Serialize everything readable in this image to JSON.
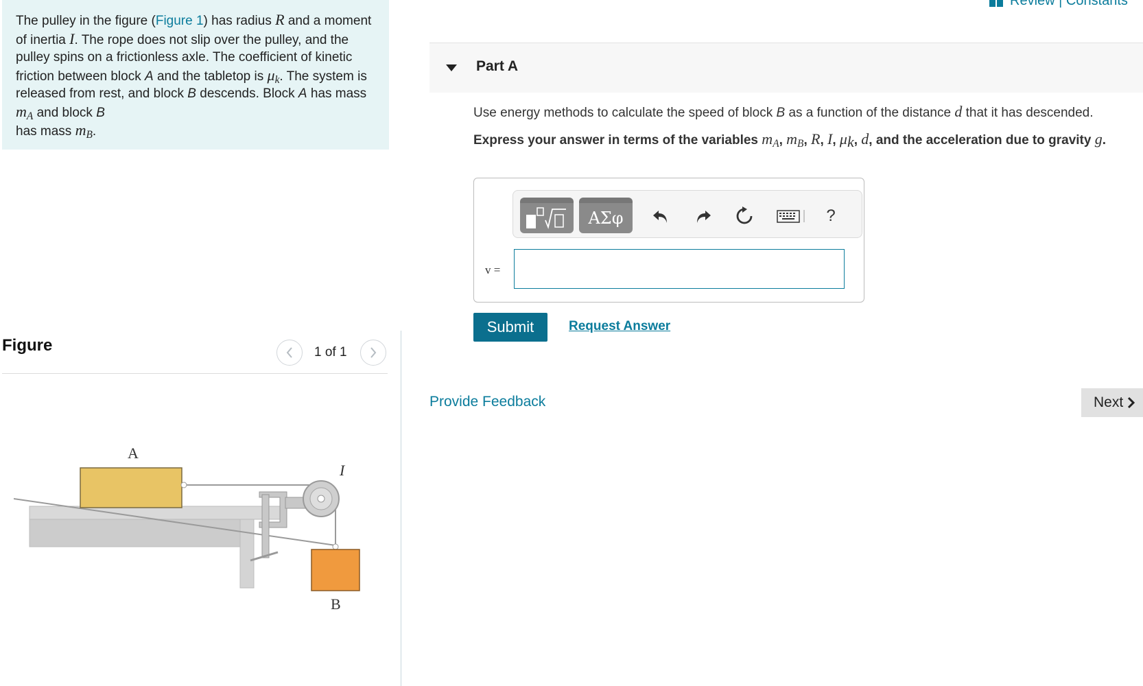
{
  "problem": {
    "t1": "The pulley in the figure (",
    "figure_link": "Figure 1",
    "t2": ") has radius ",
    "var_R": "R",
    "t3": " and a moment of inertia ",
    "var_I": "I",
    "t4": ". The rope does not slip over the pulley, and the pulley spins on a frictionless axle. The coefficient of kinetic friction between block ",
    "block_A": "A",
    "t5": " and the tabletop is ",
    "var_mu": "μ",
    "sub_k": "k",
    "t6": ". The system is released from rest, and block ",
    "block_B": "B",
    "t7": " descends. Block ",
    "t8": " has mass ",
    "var_m": "m",
    "sub_A": "A",
    "t9": " and block ",
    "t10": "has mass ",
    "sub_B": "B",
    "t11": "."
  },
  "figure": {
    "heading": "Figure",
    "counter": "1 of 1",
    "label_A": "A",
    "label_B": "B",
    "label_I": "I"
  },
  "header": {
    "review_link": "Review | Constants"
  },
  "part": {
    "title": "Part A"
  },
  "question": {
    "q1": "Use energy methods to calculate the speed of block ",
    "q_B": "B",
    "q2": " as a function of the distance ",
    "q_d": "d",
    "q3": " that it has descended."
  },
  "instructions": {
    "i1": "Express your answer in terms of the variables ",
    "vars": "m",
    "sub_A": "A",
    "sep1": ", ",
    "m2": "m",
    "sub_B": "B",
    "sep2": ", ",
    "R": "R",
    "sep3": ", ",
    "I": "I",
    "sep4": ", ",
    "mu": "μ",
    "sub_k": "k",
    "sep5": ", ",
    "d": "d",
    "i2": ", and the acceleration due to gravity ",
    "g": "g",
    "i3": "."
  },
  "toolbar": {
    "greek_label": "ΑΣφ",
    "help_label": "?"
  },
  "answer": {
    "label": "v =",
    "value": ""
  },
  "actions": {
    "submit": "Submit",
    "request_answer": "Request Answer",
    "provide_feedback": "Provide Feedback",
    "next": "Next"
  },
  "colors": {
    "accent": "#0b7c9c",
    "submit_bg": "#0b6f8e",
    "problem_bg": "#e6f4f5",
    "block_A": "#e8c465",
    "block_B": "#f09a3e"
  }
}
